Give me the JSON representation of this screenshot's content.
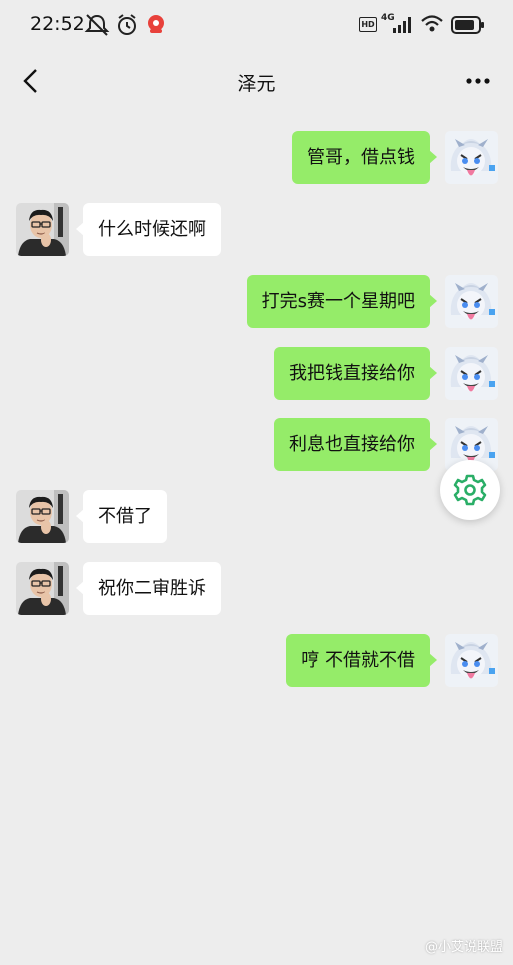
{
  "status_bar": {
    "time": "22:52",
    "hd_label": "HD",
    "network_label": "4G"
  },
  "header": {
    "title": "泽元"
  },
  "messages": [
    {
      "side": "out",
      "text": "管哥，借点钱"
    },
    {
      "side": "in",
      "text": "什么时候还啊"
    },
    {
      "side": "out",
      "text": "打完s赛一个星期吧"
    },
    {
      "side": "out",
      "text": "我把钱直接给你"
    },
    {
      "side": "out",
      "text": "利息也直接给你"
    },
    {
      "side": "in",
      "text": "不借了"
    },
    {
      "side": "in",
      "text": "祝你二审胜诉"
    },
    {
      "side": "out",
      "text": "哼 不借就不借"
    }
  ],
  "watermark": "@小艾说联盟",
  "colors": {
    "outgoing_bubble": "#95ec69",
    "incoming_bubble": "#ffffff",
    "background": "#ededed",
    "fab_icon": "#2aae67"
  }
}
